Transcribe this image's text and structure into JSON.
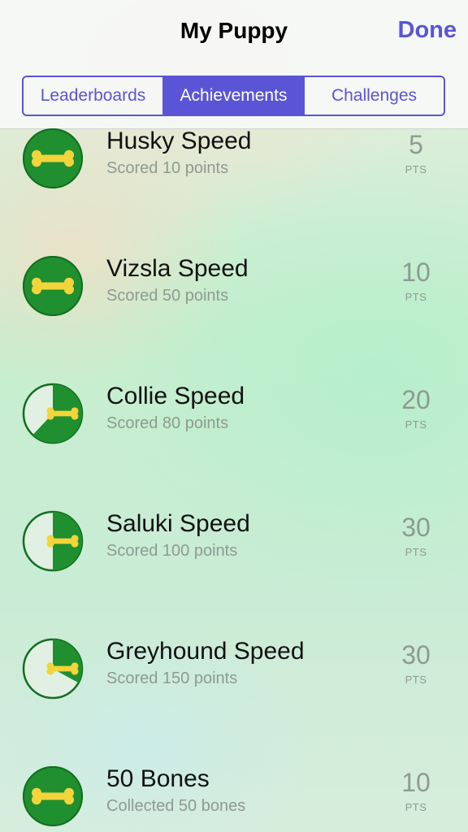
{
  "nav": {
    "title": "My Puppy",
    "done_label": "Done"
  },
  "tabs": [
    {
      "label": "Leaderboards",
      "active": false
    },
    {
      "label": "Achievements",
      "active": true
    },
    {
      "label": "Challenges",
      "active": false
    }
  ],
  "colors": {
    "accent": "#5a55d6",
    "badge_green": "#1f8f2f",
    "badge_ring": "#126e1f",
    "bone": "#f3d43a"
  },
  "achievements": [
    {
      "title": "Husky Speed",
      "subtitle": "Scored 10 points",
      "points": "5",
      "unit": "PTS",
      "progress": 1.0,
      "icon": "bone-icon"
    },
    {
      "title": "Vizsla Speed",
      "subtitle": "Scored 50 points",
      "points": "10",
      "unit": "PTS",
      "progress": 1.0,
      "icon": "bone-icon"
    },
    {
      "title": "Collie Speed",
      "subtitle": "Scored 80 points",
      "points": "20",
      "unit": "PTS",
      "progress": 0.62,
      "icon": "bone-icon"
    },
    {
      "title": "Saluki Speed",
      "subtitle": "Scored 100 points",
      "points": "30",
      "unit": "PTS",
      "progress": 0.5,
      "icon": "bone-icon"
    },
    {
      "title": "Greyhound Speed",
      "subtitle": "Scored 150 points",
      "points": "30",
      "unit": "PTS",
      "progress": 0.33,
      "icon": "bone-icon"
    },
    {
      "title": "50 Bones",
      "subtitle": "Collected 50 bones",
      "points": "10",
      "unit": "PTS",
      "progress": 1.0,
      "icon": "bone-icon"
    }
  ]
}
